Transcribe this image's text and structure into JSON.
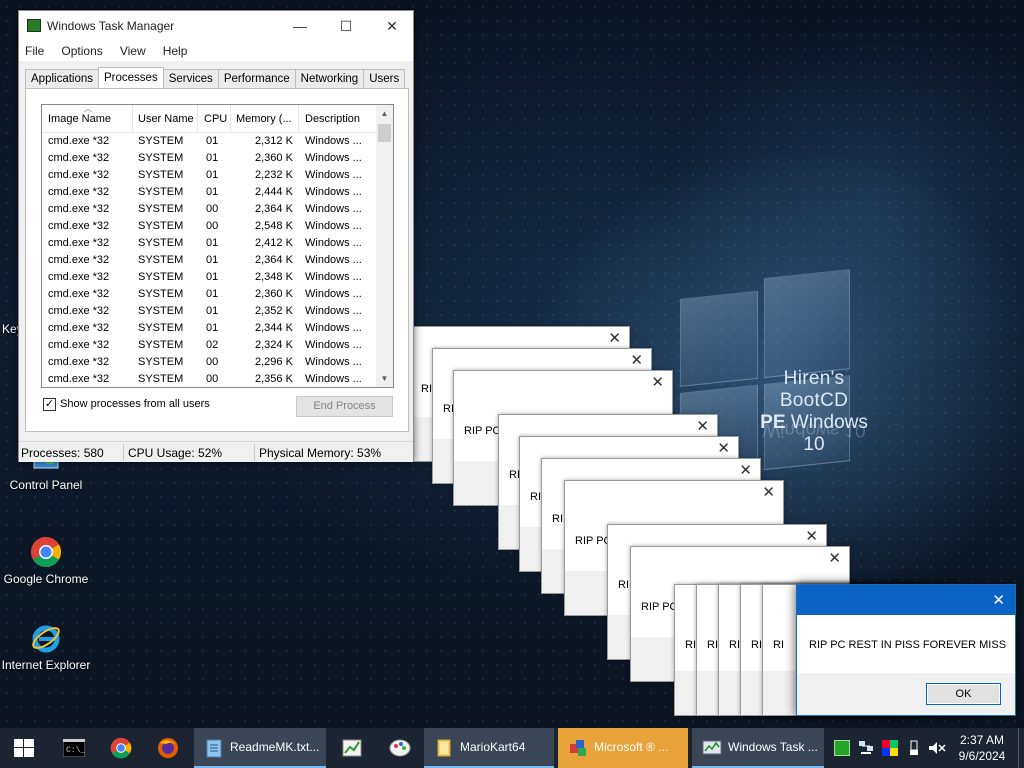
{
  "desktop": {
    "brand_line1": "Hiren's BootCD",
    "brand_line2_bold": "PE",
    "brand_line2_rest": "Windows 10",
    "icons": [
      {
        "label": "Control Panel",
        "icon": "control-panel-icon"
      },
      {
        "label": "Google Chrome",
        "icon": "chrome-icon"
      },
      {
        "label": "Internet Explorer",
        "icon": "internet-explorer-icon"
      }
    ],
    "edge_text": "Key"
  },
  "task_manager": {
    "title": "Windows Task Manager",
    "menu": [
      "File",
      "Options",
      "View",
      "Help"
    ],
    "tabs": [
      "Applications",
      "Processes",
      "Services",
      "Performance",
      "Networking",
      "Users"
    ],
    "active_tab": "Processes",
    "columns": [
      "Image Name",
      "User Name",
      "CPU",
      "Memory (...",
      "Description"
    ],
    "rows": [
      {
        "image": "cmd.exe *32",
        "user": "SYSTEM",
        "cpu": "01",
        "mem": "2,312 K",
        "desc": "Windows ..."
      },
      {
        "image": "cmd.exe *32",
        "user": "SYSTEM",
        "cpu": "01",
        "mem": "2,360 K",
        "desc": "Windows ..."
      },
      {
        "image": "cmd.exe *32",
        "user": "SYSTEM",
        "cpu": "01",
        "mem": "2,232 K",
        "desc": "Windows ..."
      },
      {
        "image": "cmd.exe *32",
        "user": "SYSTEM",
        "cpu": "01",
        "mem": "2,444 K",
        "desc": "Windows ..."
      },
      {
        "image": "cmd.exe *32",
        "user": "SYSTEM",
        "cpu": "00",
        "mem": "2,364 K",
        "desc": "Windows ..."
      },
      {
        "image": "cmd.exe *32",
        "user": "SYSTEM",
        "cpu": "00",
        "mem": "2,548 K",
        "desc": "Windows ..."
      },
      {
        "image": "cmd.exe *32",
        "user": "SYSTEM",
        "cpu": "01",
        "mem": "2,412 K",
        "desc": "Windows ..."
      },
      {
        "image": "cmd.exe *32",
        "user": "SYSTEM",
        "cpu": "01",
        "mem": "2,364 K",
        "desc": "Windows ..."
      },
      {
        "image": "cmd.exe *32",
        "user": "SYSTEM",
        "cpu": "01",
        "mem": "2,348 K",
        "desc": "Windows ..."
      },
      {
        "image": "cmd.exe *32",
        "user": "SYSTEM",
        "cpu": "01",
        "mem": "2,360 K",
        "desc": "Windows ..."
      },
      {
        "image": "cmd.exe *32",
        "user": "SYSTEM",
        "cpu": "01",
        "mem": "2,352 K",
        "desc": "Windows ..."
      },
      {
        "image": "cmd.exe *32",
        "user": "SYSTEM",
        "cpu": "01",
        "mem": "2,344 K",
        "desc": "Windows ..."
      },
      {
        "image": "cmd.exe *32",
        "user": "SYSTEM",
        "cpu": "02",
        "mem": "2,324 K",
        "desc": "Windows ..."
      },
      {
        "image": "cmd.exe *32",
        "user": "SYSTEM",
        "cpu": "00",
        "mem": "2,296 K",
        "desc": "Windows ..."
      },
      {
        "image": "cmd.exe *32",
        "user": "SYSTEM",
        "cpu": "00",
        "mem": "2,356 K",
        "desc": "Windows ..."
      }
    ],
    "show_all_label": "Show processes from all users",
    "show_all_checked": "✓",
    "end_process_label": "End Process",
    "status": {
      "processes": "Processes: 580",
      "cpu": "CPU Usage: 52%",
      "memory": "Physical Memory: 53%"
    }
  },
  "rip_dialogs": {
    "message_short": "RIP PC",
    "message_partial": "RI",
    "close_glyph": "✕"
  },
  "error_dialog": {
    "message": "RIP PC REST IN PISS FOREVER MISS",
    "ok_label": "OK",
    "close_glyph": "✕",
    "accent": "#0a64c6"
  },
  "taskbar": {
    "buttons": [
      {
        "label": "ReadmeMK.txt...",
        "icon": "notepad-icon"
      },
      {
        "label": "MarioKart64",
        "icon": "folder-icon"
      },
      {
        "label": "Microsoft ® ...",
        "icon": "microsoft-app-icon"
      },
      {
        "label": "Windows Task ...",
        "icon": "task-manager-icon"
      }
    ],
    "clock_time": "2:37 AM",
    "clock_date": "9/6/2024",
    "active_color": "#e8a33a"
  }
}
